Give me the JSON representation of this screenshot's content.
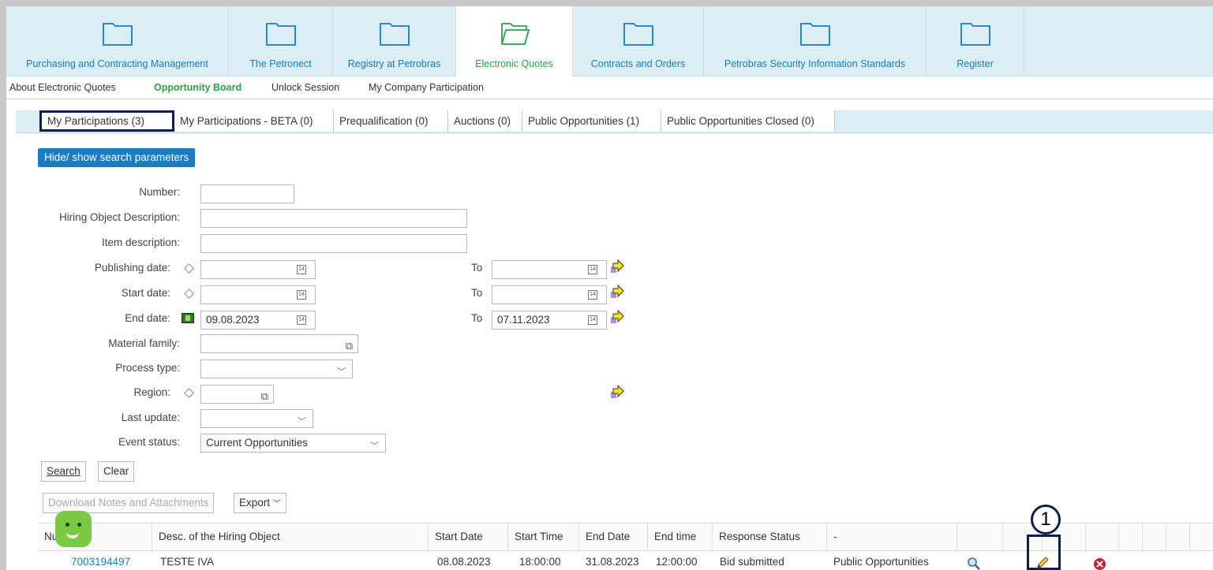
{
  "top_nav": [
    {
      "label": "Purchasing and Contracting Management",
      "active": false
    },
    {
      "label": "The Petronect",
      "active": false
    },
    {
      "label": "Registry at Petrobras",
      "active": false
    },
    {
      "label": "Electronic Quotes",
      "active": true
    },
    {
      "label": "Contracts and Orders",
      "active": false
    },
    {
      "label": "Petrobras Security Information Standards",
      "active": false
    },
    {
      "label": "Register",
      "active": false
    }
  ],
  "sub_nav": [
    "About Electronic Quotes",
    "Opportunity Board",
    "Unlock Session",
    "My Company Participation"
  ],
  "tabs": [
    "My Participations (3)",
    "My Participations - BETA (0)",
    "Prequalification (0)",
    "Auctions (0)",
    "Public Opportunities (1)",
    "Public Opportunities Closed (0)"
  ],
  "search": {
    "toggle_label": "Hide/ show search parameters",
    "number_label": "Number:",
    "hiring_desc_label": "Hiring Object Description:",
    "item_desc_label": "Item description:",
    "publishing_label": "Publishing date:",
    "start_label": "Start date:",
    "end_label": "End date:",
    "to_label": "To",
    "end_date_from": "09.08.2023",
    "end_date_to": "07.11.2023",
    "material_label": "Material family:",
    "process_label": "Process type:",
    "region_label": "Region:",
    "last_update_label": "Last update:",
    "event_status_label": "Event status:",
    "event_status_value": "Current Opportunities",
    "search_button": "Search",
    "clear_button": "Clear"
  },
  "toolbar": {
    "download_label": "Download Notes and Attachments",
    "export_label": "Export"
  },
  "table": {
    "headers": [
      "Number",
      "Desc. of the Hiring Object",
      "Start Date",
      "Start Time",
      "End Date",
      "End time",
      "Response Status",
      "-"
    ],
    "rows": [
      {
        "number": "7003194497",
        "desc": "TESTE IVA",
        "start_date": "08.08.2023",
        "start_time": "18:00:00",
        "end_date": "31.08.2023",
        "end_time": "12:00:00",
        "status": "Bid submitted",
        "type": "Public Opportunities"
      }
    ]
  },
  "marker": "1",
  "colors": {
    "nav_bg": "#daeef3",
    "link": "#1b7cb8",
    "active_green": "#2aa14a",
    "button_blue": "#1b7cc1",
    "highlight": "#0f1f4b"
  }
}
